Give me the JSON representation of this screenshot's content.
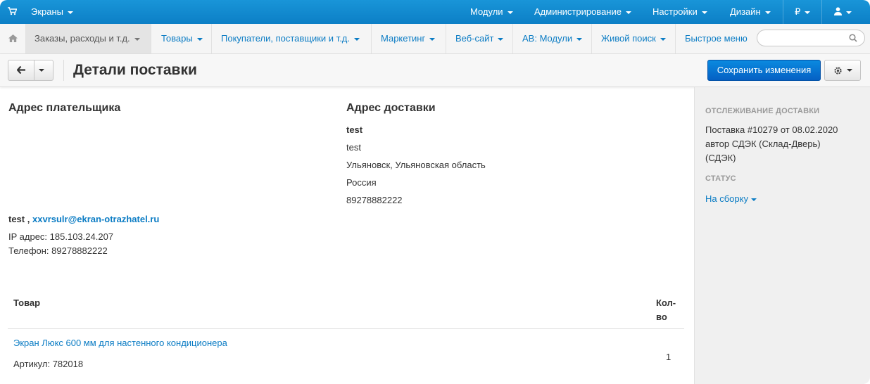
{
  "topbar": {
    "screens": "Экраны",
    "modules": "Модули",
    "admin": "Администрирование",
    "settings": "Настройки",
    "design": "Дизайн",
    "currency": "₽"
  },
  "menu": {
    "orders": "Заказы, расходы и т.д.",
    "products": "Товары",
    "customers": "Покупатели, поставщики и т.д.",
    "marketing": "Маркетинг",
    "website": "Веб-сайт",
    "ab_modules": "AB: Модули",
    "live_search": "Живой поиск",
    "quick_menu": "Быстрое меню"
  },
  "page": {
    "title": "Детали поставки",
    "save": "Сохранить изменения"
  },
  "billing": {
    "heading": "Адрес плательщика",
    "name": "test ,",
    "email": "xxvrsulr@ekran-otrazhatel.ru",
    "ip": "IP адрес: 185.103.24.207",
    "phone": "Телефон: 89278882222"
  },
  "shipping": {
    "heading": "Адрес доставки",
    "line1": "test",
    "line2": "test",
    "line3": "Ульяновск, Ульяновская область",
    "line4": "Россия",
    "line5": "89278882222"
  },
  "table": {
    "col_product": "Товар",
    "col_qty_1": "Кол-",
    "col_qty_2": "во",
    "rows": [
      {
        "name": "Экран Люкс 600 мм для настенного кондиционера",
        "sku": "Артикул: 782018",
        "qty": "1"
      }
    ]
  },
  "sidebar": {
    "tracking_heading": "Отслеживание доставки",
    "tracking_line1": "Поставка #10279 от 08.02.2020",
    "tracking_line2": "автор СДЭК (Склад-Дверь)",
    "tracking_line3": "(СДЭК)",
    "status_heading": "Статус",
    "status_value": "На сборку"
  },
  "colors": {
    "accent": "#0b7cc4",
    "topbar": "#1995d8",
    "primary_button": "#0a6fd4"
  }
}
